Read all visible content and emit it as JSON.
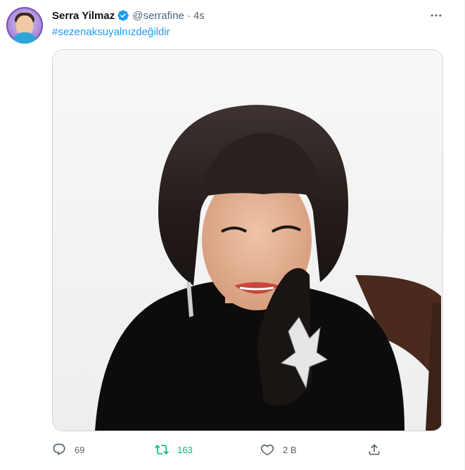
{
  "author": {
    "display_name": "Serra Yilmaz",
    "handle": "@serrafine",
    "separator": "·",
    "time": "4s",
    "verified": true,
    "avatar_icon": "avatar-photo"
  },
  "tweet": {
    "hashtag": "#sezenaksuyalnızdeğildir",
    "media_icon": "photo"
  },
  "actions": {
    "reply_count": "69",
    "retweet_count": "163",
    "like_count": "2 B",
    "retweeted": true
  },
  "colors": {
    "accent": "#1d9bf0",
    "retweet_green": "#00ba7c",
    "secondary_text": "#536471",
    "border": "#cfd9de"
  }
}
